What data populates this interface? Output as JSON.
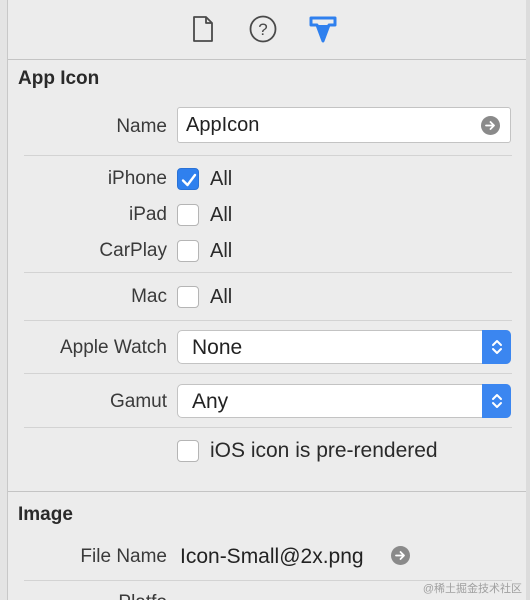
{
  "toolbar": {
    "icons": [
      "file-inspector-icon",
      "quick-help-icon",
      "attributes-inspector-icon"
    ],
    "accent_color": "#2f80ee"
  },
  "app_icon": {
    "section_title": "App Icon",
    "name_label": "Name",
    "name_value": "AppIcon",
    "devices": [
      {
        "label": "iPhone",
        "option": "All",
        "checked": true
      },
      {
        "label": "iPad",
        "option": "All",
        "checked": false
      },
      {
        "label": "CarPlay",
        "option": "All",
        "checked": false
      },
      {
        "label": "Mac",
        "option": "All",
        "checked": false
      }
    ],
    "apple_watch_label": "Apple Watch",
    "apple_watch_value": "None",
    "gamut_label": "Gamut",
    "gamut_value": "Any",
    "prerendered_label": "iOS icon is pre-rendered",
    "prerendered_checked": false
  },
  "image": {
    "section_title": "Image",
    "file_name_label": "File Name",
    "file_name_value": "Icon-Small@2x.png",
    "platform_label": "Platfo"
  },
  "watermark": "@稀土掘金技术社区"
}
